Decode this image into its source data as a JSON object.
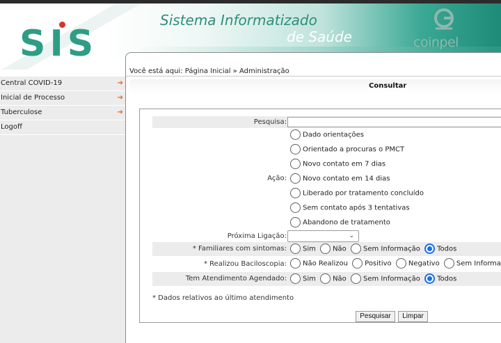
{
  "header": {
    "logo": "SIS",
    "title_line1": "Sistema Informatizado",
    "title_line2": "de Saúde",
    "company": "coinpel"
  },
  "sidebar": {
    "items": [
      {
        "label": "Central COVID-19",
        "has_submenu": true
      },
      {
        "label": "Inicial de Processo",
        "has_submenu": true
      },
      {
        "label": "Tuberculose",
        "has_submenu": true
      },
      {
        "label": "Logoff",
        "has_submenu": false
      }
    ]
  },
  "breadcrumb": "Você está aqui: Página Inicial » Administração",
  "panel_title": "Consultar",
  "form": {
    "pesquisa": {
      "label": "Pesquisa:",
      "value": ""
    },
    "acao": {
      "label": "Ação:",
      "options": [
        "Dado orientações",
        "Orientado a procuras o PMCT",
        "Novo contato em 7 dias",
        "Novo contato em 14 dias",
        "Liberado por tratamento concluído",
        "Sem contato após 3 tentativas",
        "Abandono de tratamento"
      ],
      "selected": null
    },
    "proxima_ligacao": {
      "label": "Próxima Ligação:",
      "value": ""
    },
    "familiares": {
      "label": "* Familiares com sintomas:",
      "options": [
        "Sim",
        "Não",
        "Sem Informação",
        "Todos"
      ],
      "selected": "Todos"
    },
    "baciloscopia": {
      "label": "* Realizou Baciloscopia:",
      "options": [
        "Não Realizou",
        "Positivo",
        "Negativo",
        "Sem Informação"
      ],
      "selected": null
    },
    "atendimento": {
      "label": "Tem Atendimento Agendado:",
      "options": [
        "Sim",
        "Não",
        "Sem Informação",
        "Todos"
      ],
      "selected": "Todos"
    },
    "note": "* Dados relativos ao último atendimento",
    "search_button": "Pesquisar",
    "clear_button": "Limpar"
  },
  "colors": {
    "brand_green": "#2f9d86",
    "brand_red": "#d9342b",
    "radio_selected": "#1a6ee6",
    "menu_arrow": "#e06a1b"
  }
}
